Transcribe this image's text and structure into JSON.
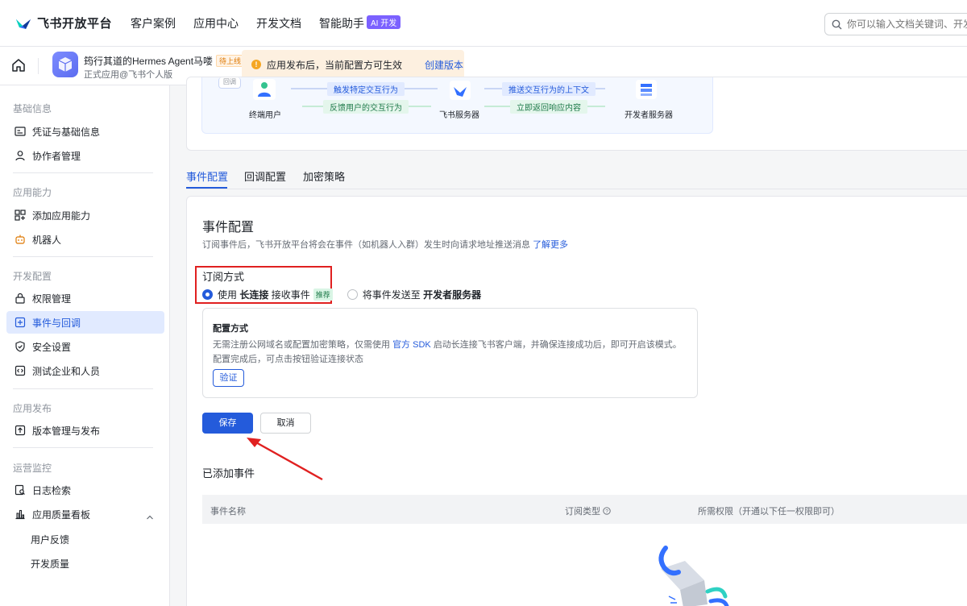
{
  "topnav": {
    "brand": "飞书开放平台",
    "items": [
      "客户案例",
      "应用中心",
      "开发文档",
      "智能助手"
    ],
    "ai_badge": "AI 开发",
    "search_placeholder": "你可以输入文档关键词、开发问题"
  },
  "appbar": {
    "app_name": "筠行其道的Hermes Agent马喽",
    "status_badge": "待上线",
    "app_type": "正式应用@飞书个人版",
    "notice_text": "应用发布后，当前配置方可生效",
    "notice_link": "创建版本"
  },
  "sidebar": {
    "groups": [
      {
        "title": "基础信息",
        "items": [
          "凭证与基础信息",
          "协作者管理"
        ]
      },
      {
        "title": "应用能力",
        "items": [
          "添加应用能力",
          "机器人"
        ]
      },
      {
        "title": "开发配置",
        "items": [
          "权限管理",
          "事件与回调",
          "安全设置",
          "测试企业和人员"
        ]
      },
      {
        "title": "应用发布",
        "items": [
          "版本管理与发布"
        ]
      },
      {
        "title": "运营监控",
        "items": [
          "日志检索",
          "应用质量看板"
        ]
      }
    ],
    "sub_items": [
      "用户反馈",
      "开发质量"
    ],
    "active": "事件与回调"
  },
  "flow": {
    "left_node": "终端用户",
    "mid_node": "飞书服务器",
    "right_node": "开发者服务器",
    "arrow1": "触发特定交互行为",
    "arrow2": "反馈用户的交互行为",
    "arrow3": "推送交互行为的上下文",
    "arrow4": "立即返回响应内容",
    "partial_top": "回调"
  },
  "tabs": [
    "事件配置",
    "回调配置",
    "加密策略"
  ],
  "event_config": {
    "title": "事件配置",
    "desc": "订阅事件后，飞书开放平台将会在事件（如机器人入群）发生时向请求地址推送消息",
    "learn_more": "了解更多",
    "subscribe_label": "订阅方式",
    "option1_prefix": "使用",
    "option1_bold": "长连接",
    "option1_suffix": "接收事件",
    "recommended": "推荐",
    "option2_prefix": "将事件发送至",
    "option2_bold": "开发者服务器",
    "config_title": "配置方式",
    "config_line1_a": "无需注册公网域名或配置加密策略，仅需使用",
    "config_line1_link": "官方 SDK",
    "config_line1_b": "启动长连接飞书客户端，并确保连接成功后，即可开启该模式。",
    "config_line2": "配置完成后，可点击按钮验证连接状态",
    "verify": "验证",
    "save": "保存",
    "cancel": "取消"
  },
  "added_events": {
    "title": "已添加事件",
    "columns": [
      "事件名称",
      "订阅类型",
      "所需权限（开通以下任一权限即可）"
    ]
  },
  "colors": {
    "primary": "#245bdb",
    "highlight_box": "#e02020",
    "arrow": "#e02020"
  }
}
